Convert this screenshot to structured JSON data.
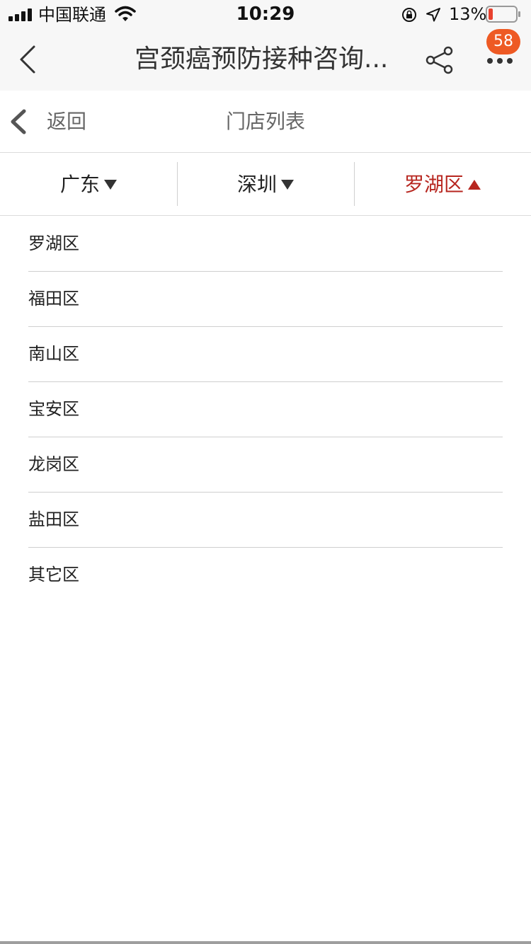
{
  "status_bar": {
    "carrier": "中国联通",
    "time": "10:29",
    "battery_percent": "13%",
    "battery_level": 0.13,
    "battery_color": "#e8412e"
  },
  "nav": {
    "title": "宫颈癌预防接种咨询...",
    "badge_count": "58",
    "badge_color": "#ee5a24",
    "icons": {
      "back": "chevron-left-icon",
      "share": "share-icon",
      "more": "more-dots-icon"
    }
  },
  "sub_header": {
    "back_label": "返回",
    "title": "门店列表"
  },
  "filters": [
    {
      "label": "广东",
      "state": "collapsed"
    },
    {
      "label": "深圳",
      "state": "collapsed"
    },
    {
      "label": "罗湖区",
      "state": "expanded"
    }
  ],
  "accent_color": "#b7261f",
  "districts": [
    {
      "label": "罗湖区"
    },
    {
      "label": "福田区"
    },
    {
      "label": "南山区"
    },
    {
      "label": "宝安区"
    },
    {
      "label": "龙岗区"
    },
    {
      "label": "盐田区"
    },
    {
      "label": "其它区"
    }
  ]
}
